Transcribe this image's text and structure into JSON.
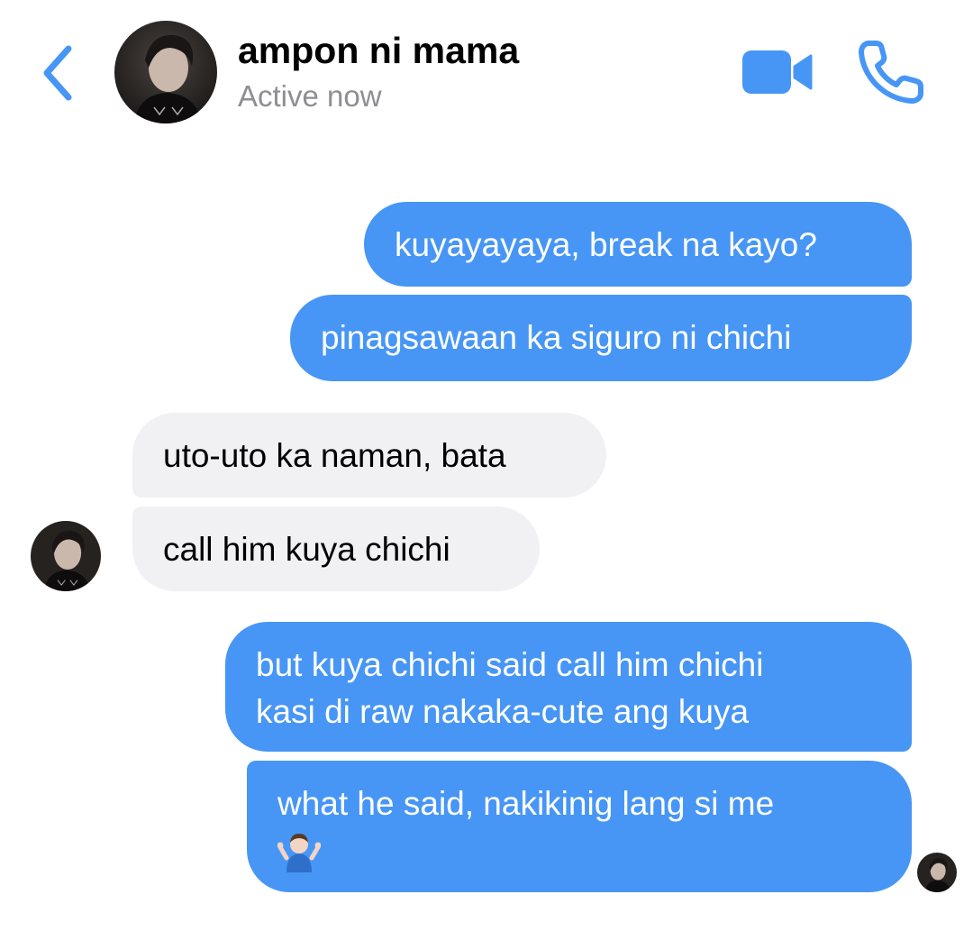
{
  "header": {
    "back_icon": "chevron-left-icon",
    "contact_name": "ampon ni mama",
    "status": "Active now",
    "video_icon": "video-camera-icon",
    "phone_icon": "phone-icon",
    "accent_color": "#4796f5"
  },
  "messages": [
    {
      "sender": "me",
      "text": "kuyayayaya, break na kayo?"
    },
    {
      "sender": "me",
      "text": "pinagsawaan ka siguro ni chichi"
    },
    {
      "sender": "contact",
      "text": "uto-uto ka naman, bata"
    },
    {
      "sender": "contact",
      "text": "call him kuya chichi"
    },
    {
      "sender": "me",
      "lines": [
        "but kuya chichi said call him chichi",
        "kasi di raw nakaka-cute ang kuya"
      ]
    },
    {
      "sender": "me",
      "lines": [
        "what he said, nakikinig lang si me"
      ],
      "emoji": "person-shrugging-emoji"
    }
  ],
  "colors": {
    "outgoing_bubble": "#4796f5",
    "incoming_bubble": "#f1f1f4",
    "status_gray": "#8e8e93"
  }
}
